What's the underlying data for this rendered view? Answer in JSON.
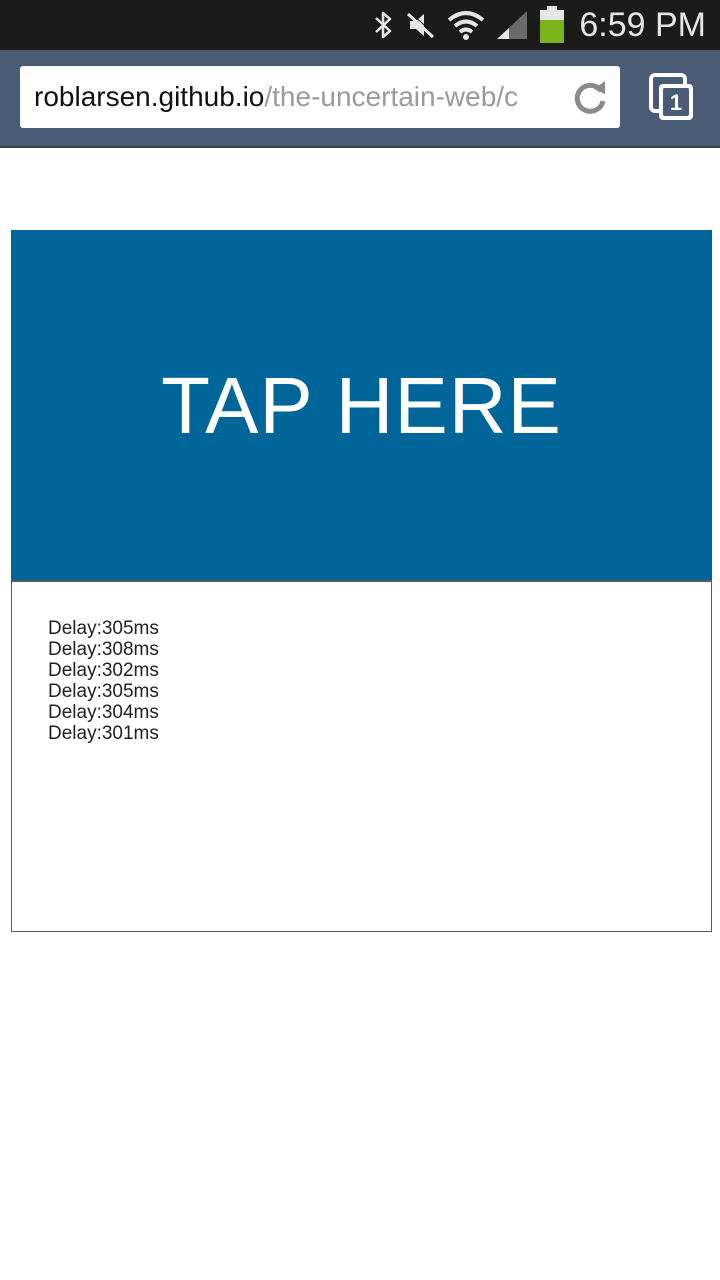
{
  "status_bar": {
    "time": "6:59 PM",
    "icons": [
      "bluetooth-icon",
      "mute-icon",
      "wifi-icon",
      "signal-icon",
      "battery-icon"
    ],
    "battery_color": "#7cb21a"
  },
  "browser": {
    "url_host": "roblarsen.github.io",
    "url_path": "/the-uncertain-web/c",
    "tab_count": "1",
    "toolbar_color": "#4a5b76"
  },
  "page": {
    "tap_label": "TAP HERE",
    "tap_color": "#006699",
    "log": [
      "Delay:305ms",
      "Delay:308ms",
      "Delay:302ms",
      "Delay:305ms",
      "Delay:304ms",
      "Delay:301ms"
    ]
  }
}
